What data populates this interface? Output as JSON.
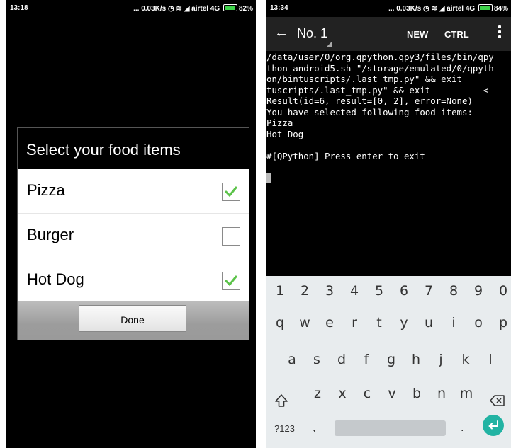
{
  "left_status": {
    "time": "13:18",
    "info": "... 0.03K/s",
    "carrier": "airtel 4G",
    "battery": "82%"
  },
  "dialog": {
    "title": "Select your food items",
    "items": [
      {
        "label": "Pizza",
        "checked": true
      },
      {
        "label": "Burger",
        "checked": false
      },
      {
        "label": "Hot Dog",
        "checked": true
      }
    ],
    "done_label": "Done"
  },
  "right_status": {
    "time": "13:34",
    "info": "... 0.03K/s",
    "carrier": "airtel 4G",
    "battery": "84%"
  },
  "toolbar": {
    "title": "No. 1",
    "new_label": "NEW",
    "ctrl_label": "CTRL"
  },
  "terminal": {
    "lines": [
      "/data/user/0/org.qpython.qpy3/files/bin/qpy",
      "thon-android5.sh \"/storage/emulated/0/qpyth",
      "on/bintuscripts/.last_tmp.py\" && exit",
      "tuscripts/.last_tmp.py\" && exit          <",
      "Result(id=6, result=[0, 2], error=None)",
      "You have selected following food items:",
      "Pizza",
      "Hot Dog",
      "",
      "#[QPython] Press enter to exit"
    ]
  },
  "keyboard": {
    "numbers": [
      "1",
      "2",
      "3",
      "4",
      "5",
      "6",
      "7",
      "8",
      "9",
      "0"
    ],
    "row1": [
      "q",
      "w",
      "e",
      "r",
      "t",
      "y",
      "u",
      "i",
      "o",
      "p"
    ],
    "row2": [
      "a",
      "s",
      "d",
      "f",
      "g",
      "h",
      "j",
      "k",
      "l"
    ],
    "row3": [
      "z",
      "x",
      "c",
      "v",
      "b",
      "n",
      "m"
    ],
    "symbols_label": "?123",
    "comma": ",",
    "period": "."
  },
  "colors": {
    "check": "#5cc34a",
    "enter_key": "#22b3a3",
    "toolbar": "#222222",
    "keyboard": "#e8ecee"
  }
}
